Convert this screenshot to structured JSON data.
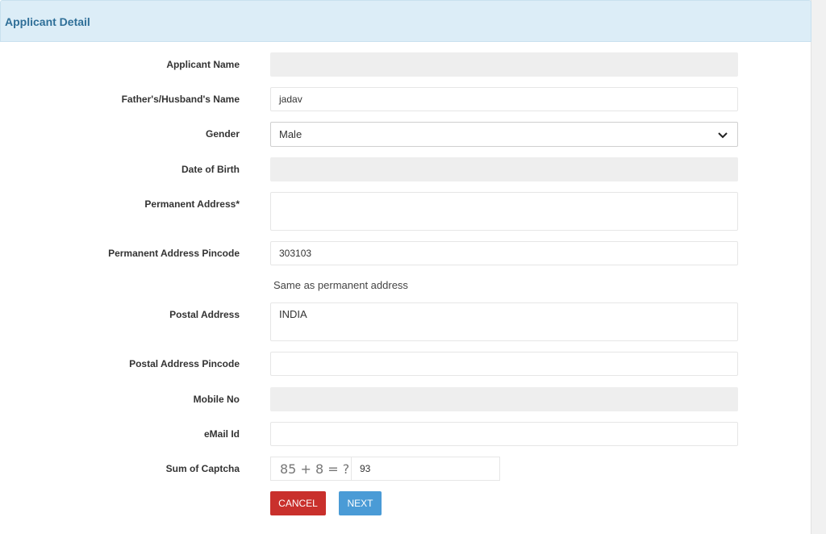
{
  "panel": {
    "title": "Applicant Detail"
  },
  "form": {
    "applicant_name": {
      "label": "Applicant Name",
      "value": ""
    },
    "father_name": {
      "label": "Father's/Husband's Name",
      "value": "jadav"
    },
    "gender": {
      "label": "Gender",
      "value": "Male"
    },
    "dob": {
      "label": "Date of Birth",
      "value": ""
    },
    "permanent_address": {
      "label": "Permanent Address*",
      "value": ""
    },
    "permanent_pincode": {
      "label": "Permanent Address Pincode",
      "value": "303103"
    },
    "same_address_note": "Same as permanent address",
    "postal_address": {
      "label": "Postal Address",
      "value": "INDIA"
    },
    "postal_pincode": {
      "label": "Postal Address Pincode",
      "value": ""
    },
    "mobile": {
      "label": "Mobile No",
      "value": ""
    },
    "email": {
      "label": "eMail Id",
      "value": ""
    },
    "captcha": {
      "label": "Sum of Captcha",
      "question": "85 + 8 = ?",
      "answer": "93"
    }
  },
  "buttons": {
    "cancel": "CANCEL",
    "next": "NEXT"
  },
  "colors": {
    "header_bg": "#dcedf7",
    "title": "#2f6f98",
    "cancel": "#c9302c",
    "next": "#4a9bd6"
  }
}
